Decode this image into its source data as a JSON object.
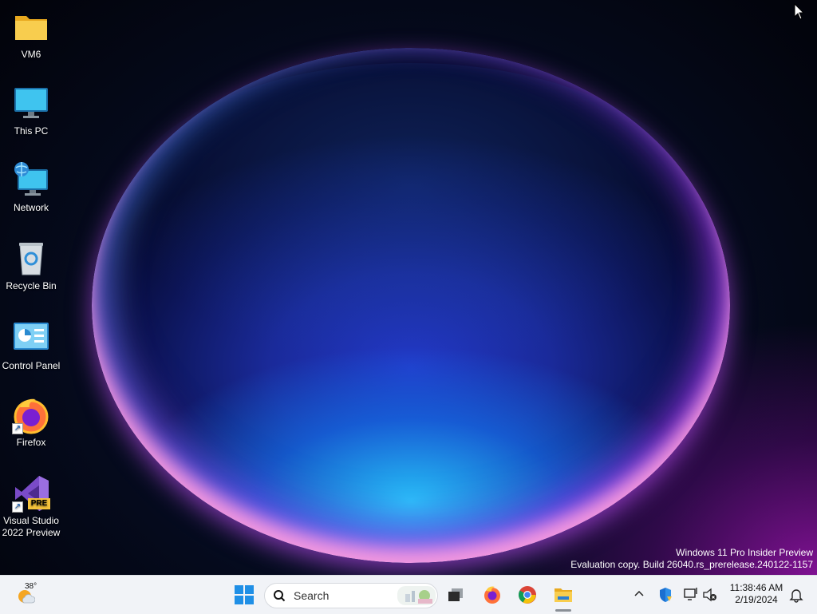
{
  "desktop": {
    "icons": [
      {
        "label": "VM6",
        "icon": "folder-icon"
      },
      {
        "label": "This PC",
        "icon": "monitor-icon"
      },
      {
        "label": "Network",
        "icon": "network-icon"
      },
      {
        "label": "Recycle Bin",
        "icon": "recycle-bin-icon"
      },
      {
        "label": "Control Panel",
        "icon": "control-panel-icon"
      },
      {
        "label": "Firefox",
        "icon": "firefox-icon"
      },
      {
        "label_line1": "Visual Studio",
        "label_line2": "2022 Preview",
        "icon": "visual-studio-icon",
        "badge": "PRE"
      }
    ],
    "watermark": {
      "line1": "Windows 11 Pro Insider Preview",
      "line2": "Evaluation copy. Build 26040.rs_prerelease.240122-1157"
    }
  },
  "taskbar": {
    "weather": {
      "temp": "38°",
      "icon": "weather-sun-cloud-icon"
    },
    "start": {
      "icon": "windows-start-icon"
    },
    "search": {
      "placeholder": "Search"
    },
    "pinned": [
      {
        "name": "task-view",
        "icon": "task-view-icon"
      },
      {
        "name": "firefox",
        "icon": "firefox-icon"
      },
      {
        "name": "chrome",
        "icon": "chrome-icon"
      },
      {
        "name": "file-explorer",
        "icon": "file-explorer-icon"
      }
    ],
    "tray": {
      "icons": [
        "chevron-up-icon",
        "defender-shield-icon",
        "network-status-icon",
        "volume-muted-icon"
      ],
      "time": "11:38:46 AM",
      "date": "2/19/2024",
      "notification_icon": "bell-icon"
    }
  },
  "colors": {
    "taskbar_bg": "#f1f3f7",
    "start_blue": "#1f8fe6",
    "folder_yellow": "#f5c042"
  }
}
